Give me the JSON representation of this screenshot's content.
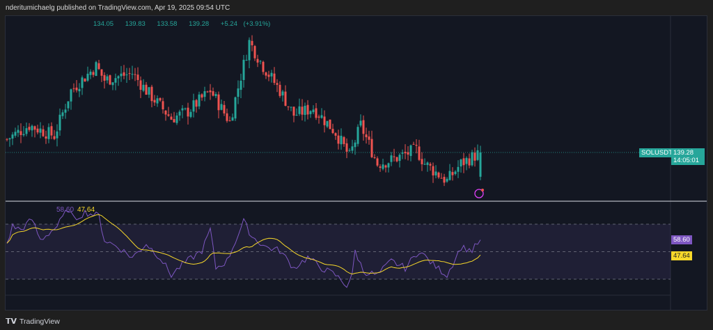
{
  "header": {
    "published": "nderitumichaelg published on TradingView.com, Apr 19, 2025 09:54 UTC"
  },
  "ohlc": {
    "open": "134.05",
    "high": "139.83",
    "low": "133.58",
    "close": "139.28",
    "change": "+5.24 (+3.91%)"
  },
  "price_axis": {
    "symbol": "SOLUSDT",
    "last_price": "139.28",
    "countdown": "14:05:01"
  },
  "rsi": {
    "value_label": "58.60",
    "ma_label": "47.64"
  },
  "footer": {
    "brand": "TradingView"
  },
  "colors": {
    "up": "#26a69a",
    "down": "#ef5350",
    "rsi": "#7e57c2",
    "ma": "#f7d82a"
  },
  "chart_data": [
    {
      "type": "candlestick",
      "title": "SOLUSDT",
      "candle_count": 171,
      "close_keypoints": [
        [
          0,
          142.13
        ],
        [
          8,
          145.13
        ],
        [
          17,
          142.88
        ],
        [
          23,
          152.63
        ],
        [
          32,
          157.88
        ],
        [
          35,
          154.88
        ],
        [
          45,
          156.38
        ],
        [
          50,
          152.63
        ],
        [
          59,
          146.63
        ],
        [
          65,
          148.13
        ],
        [
          73,
          152.63
        ],
        [
          80,
          145.88
        ],
        [
          87,
          163.13
        ],
        [
          92,
          157.88
        ],
        [
          98,
          152.63
        ],
        [
          103,
          147.38
        ],
        [
          110,
          148.88
        ],
        [
          118,
          143.63
        ],
        [
          123,
          138.38
        ],
        [
          127,
          145.13
        ],
        [
          133,
          136.88
        ],
        [
          138,
          137.63
        ],
        [
          147,
          139.88
        ],
        [
          150,
          136.88
        ],
        [
          158,
          133.13
        ],
        [
          163,
          136.88
        ],
        [
          170,
          139.28
        ]
      ],
      "last": {
        "open": 134.05,
        "high": 139.83,
        "low": 133.58,
        "close": 139.28
      }
    },
    {
      "type": "line",
      "title": "RSI",
      "levels": [
        70,
        50,
        30
      ],
      "rsi_keypoints": [
        [
          0,
          55.8
        ],
        [
          2,
          68.5
        ],
        [
          5,
          66.0
        ],
        [
          9,
          73.5
        ],
        [
          12,
          58.4
        ],
        [
          18,
          68.5
        ],
        [
          22,
          81.1
        ],
        [
          24,
          73.5
        ],
        [
          28,
          78.6
        ],
        [
          33,
          76.1
        ],
        [
          35,
          58.4
        ],
        [
          40,
          53.3
        ],
        [
          45,
          45.7
        ],
        [
          50,
          55.8
        ],
        [
          55,
          45.7
        ],
        [
          59,
          33.0
        ],
        [
          63,
          40.6
        ],
        [
          70,
          50.8
        ],
        [
          73,
          66.0
        ],
        [
          75,
          38.1
        ],
        [
          79,
          43.2
        ],
        [
          85,
          72.0
        ],
        [
          88,
          60.9
        ],
        [
          93,
          53.3
        ],
        [
          98,
          50.8
        ],
        [
          103,
          38.1
        ],
        [
          108,
          45.7
        ],
        [
          113,
          38.1
        ],
        [
          118,
          33.0
        ],
        [
          122,
          25.4
        ],
        [
          124,
          33.0
        ],
        [
          125,
          50.8
        ],
        [
          128,
          35.6
        ],
        [
          133,
          33.0
        ],
        [
          138,
          43.2
        ],
        [
          143,
          38.1
        ],
        [
          148,
          50.8
        ],
        [
          153,
          40.6
        ],
        [
          158,
          33.0
        ],
        [
          163,
          53.3
        ],
        [
          167,
          50.8
        ],
        [
          170,
          58.6
        ]
      ],
      "ma_period": 14,
      "rsi_last": 58.6,
      "ma_last": 47.64
    }
  ]
}
